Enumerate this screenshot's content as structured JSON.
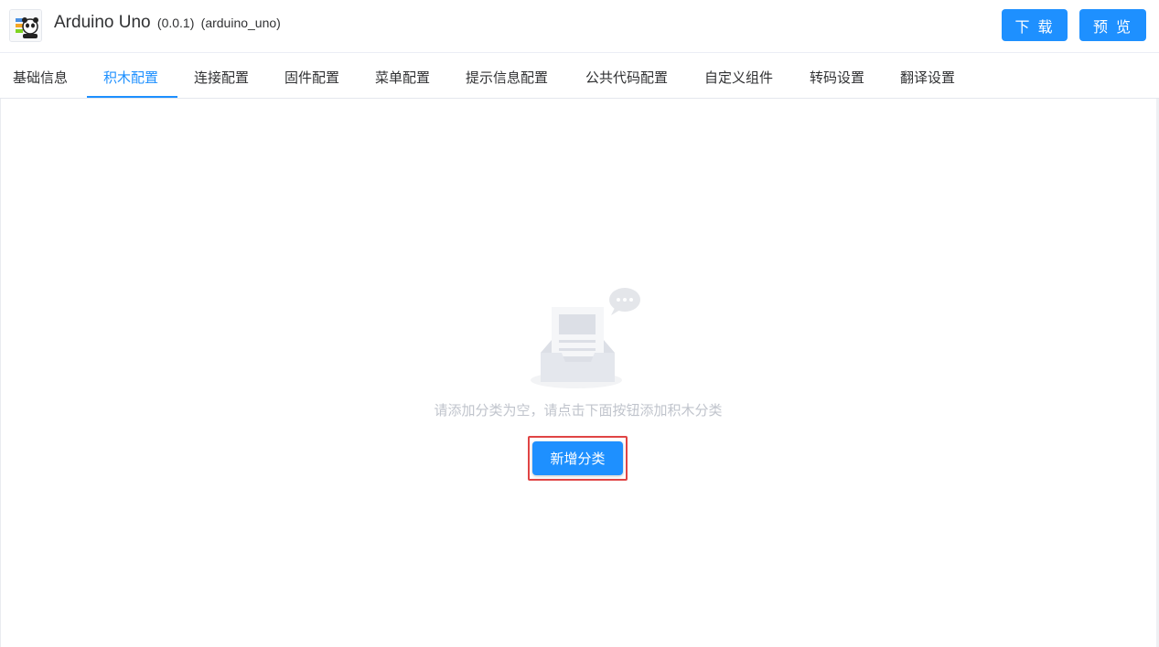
{
  "header": {
    "logo_icon": "panda-logo-icon",
    "title": "Arduino Uno",
    "version": "(0.0.1)",
    "id": "(arduino_uno)",
    "download_label": "下 载",
    "preview_label": "预 览"
  },
  "tabs": [
    {
      "label": "基础信息",
      "active": false
    },
    {
      "label": "积木配置",
      "active": true
    },
    {
      "label": "连接配置",
      "active": false
    },
    {
      "label": "固件配置",
      "active": false
    },
    {
      "label": "菜单配置",
      "active": false
    },
    {
      "label": "提示信息配置",
      "active": false
    },
    {
      "label": "公共代码配置",
      "active": false
    },
    {
      "label": "自定义组件",
      "active": false
    },
    {
      "label": "转码设置",
      "active": false
    },
    {
      "label": "翻译设置",
      "active": false
    }
  ],
  "main": {
    "empty_icon": "empty-inbox-icon",
    "empty_text": "请添加分类为空，请点击下面按钮添加积木分类",
    "add_category_label": "新增分类"
  },
  "colors": {
    "primary": "#1e90ff",
    "highlight_border": "#e04444",
    "muted_text": "#c0c4cc"
  }
}
